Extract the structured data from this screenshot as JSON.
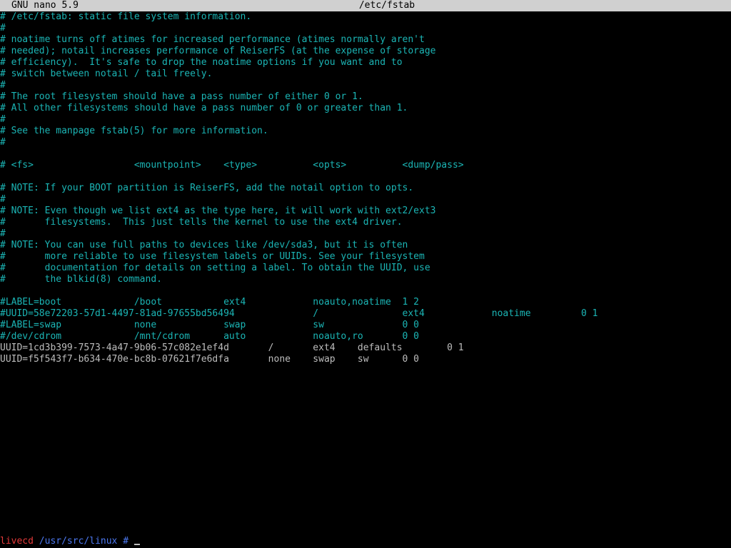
{
  "title_bar": {
    "program": "GNU nano 5.9",
    "filename": "/etc/fstab"
  },
  "lines": [
    {
      "text": "# /etc/fstab: static file system information.",
      "kind": "comment"
    },
    {
      "text": "#",
      "kind": "comment"
    },
    {
      "text": "# noatime turns off atimes for increased performance (atimes normally aren't",
      "kind": "comment"
    },
    {
      "text": "# needed); notail increases performance of ReiserFS (at the expense of storage",
      "kind": "comment"
    },
    {
      "text": "# efficiency).  It's safe to drop the noatime options if you want and to",
      "kind": "comment"
    },
    {
      "text": "# switch between notail / tail freely.",
      "kind": "comment"
    },
    {
      "text": "#",
      "kind": "comment"
    },
    {
      "text": "# The root filesystem should have a pass number of either 0 or 1.",
      "kind": "comment"
    },
    {
      "text": "# All other filesystems should have a pass number of 0 or greater than 1.",
      "kind": "comment"
    },
    {
      "text": "#",
      "kind": "comment"
    },
    {
      "text": "# See the manpage fstab(5) for more information.",
      "kind": "comment"
    },
    {
      "text": "#",
      "kind": "comment"
    },
    {
      "text": "",
      "kind": "blank"
    },
    {
      "text": "# <fs>                  <mountpoint>    <type>          <opts>          <dump/pass>",
      "kind": "comment"
    },
    {
      "text": "",
      "kind": "blank"
    },
    {
      "text": "# NOTE: If your BOOT partition is ReiserFS, add the notail option to opts.",
      "kind": "comment"
    },
    {
      "text": "#",
      "kind": "comment"
    },
    {
      "text": "# NOTE: Even though we list ext4 as the type here, it will work with ext2/ext3",
      "kind": "comment"
    },
    {
      "text": "#       filesystems.  This just tells the kernel to use the ext4 driver.",
      "kind": "comment"
    },
    {
      "text": "#",
      "kind": "comment"
    },
    {
      "text": "# NOTE: You can use full paths to devices like /dev/sda3, but it is often",
      "kind": "comment"
    },
    {
      "text": "#       more reliable to use filesystem labels or UUIDs. See your filesystem",
      "kind": "comment"
    },
    {
      "text": "#       documentation for details on setting a label. To obtain the UUID, use",
      "kind": "comment"
    },
    {
      "text": "#       the blkid(8) command.",
      "kind": "comment"
    },
    {
      "text": "",
      "kind": "blank"
    },
    {
      "text": "#LABEL=boot             /boot           ext4            noauto,noatime  1 2",
      "kind": "comment"
    },
    {
      "text": "#UUID=58e72203-57d1-4497-81ad-97655bd56494              /               ext4            noatime         0 1",
      "kind": "comment"
    },
    {
      "text": "#LABEL=swap             none            swap            sw              0 0",
      "kind": "comment"
    },
    {
      "text": "#/dev/cdrom             /mnt/cdrom      auto            noauto,ro       0 0",
      "kind": "comment"
    },
    {
      "text": "UUID=1cd3b399-7573-4a47-9b06-57c082e1ef4d       /       ext4    defaults        0 1",
      "kind": "code"
    },
    {
      "text": "UUID=f5f543f7-b634-470e-bc8b-07621f7e6dfa       none    swap    sw      0 0",
      "kind": "code"
    }
  ],
  "prompt": {
    "host": "livecd",
    "path": "/usr/src/linux",
    "symbol": "#"
  }
}
